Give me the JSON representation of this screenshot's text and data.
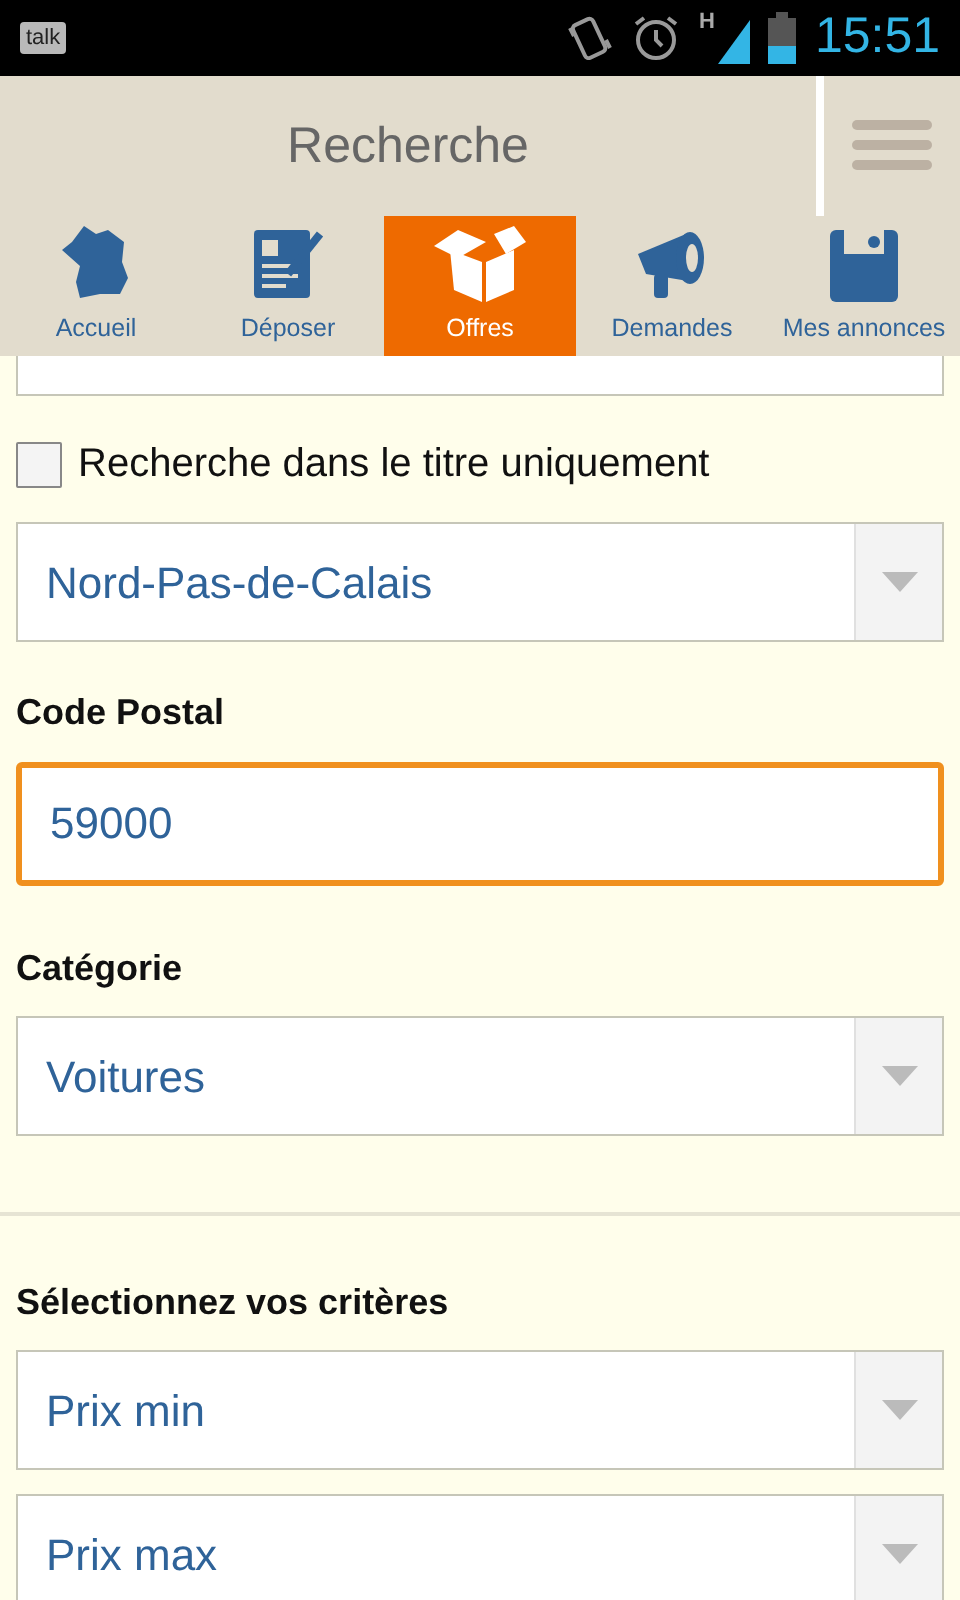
{
  "status_bar": {
    "app": "talk",
    "network": "H",
    "time": "15:51"
  },
  "header": {
    "title": "Recherche"
  },
  "tabs": [
    {
      "label": "Accueil",
      "kind": "map",
      "selected": false
    },
    {
      "label": "Déposer",
      "kind": "form",
      "selected": false
    },
    {
      "label": "Offres",
      "kind": "box",
      "selected": true
    },
    {
      "label": "Demandes",
      "kind": "megaphone",
      "selected": false
    },
    {
      "label": "Mes annonces",
      "kind": "disk",
      "selected": false
    }
  ],
  "title_only": {
    "label": "Recherche dans le titre uniquement",
    "checked": false
  },
  "region": {
    "value": "Nord-Pas-de-Calais"
  },
  "postal_code": {
    "label": "Code Postal",
    "value": "59000",
    "focused": true
  },
  "category": {
    "label": "Catégorie",
    "value": "Voitures"
  },
  "criteria": {
    "label": "Sélectionnez vos critères",
    "selects": [
      {
        "value": "Prix min"
      },
      {
        "value": "Prix max"
      }
    ]
  }
}
